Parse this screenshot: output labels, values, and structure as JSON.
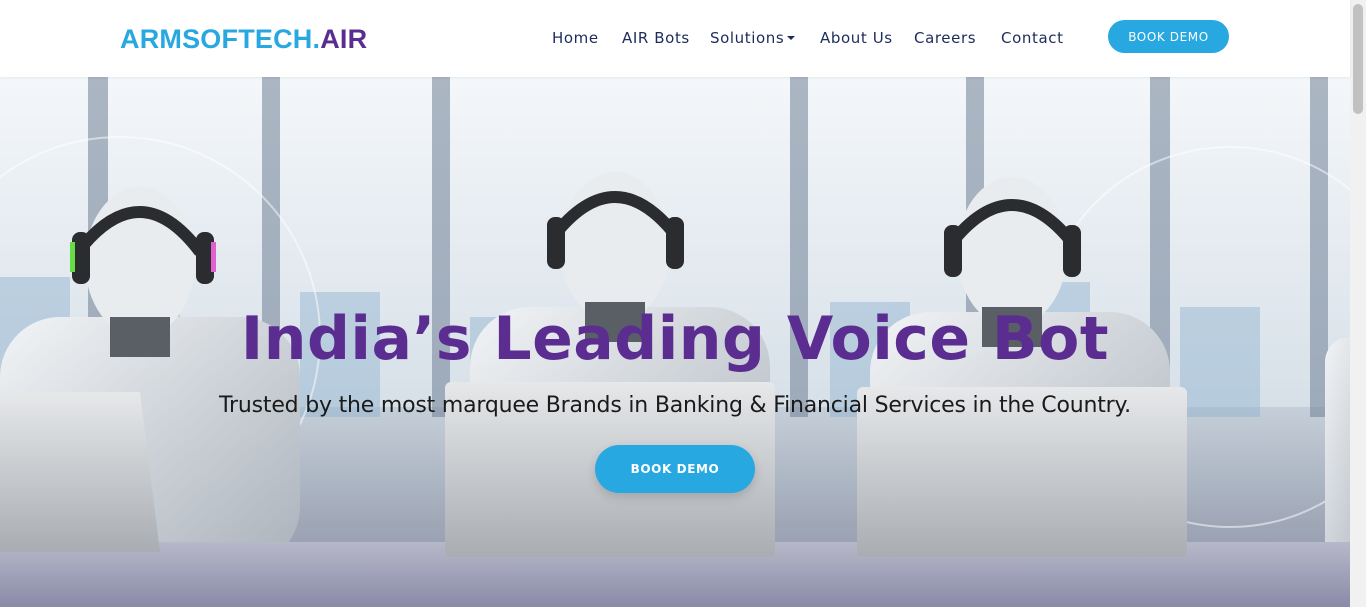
{
  "brand": {
    "logo_part1": "ARMSOFTECH.",
    "logo_part2": "AIR"
  },
  "nav": {
    "items": [
      {
        "label": "Home"
      },
      {
        "label": "AIR Bots"
      },
      {
        "label": "Solutions",
        "has_dropdown": true
      },
      {
        "label": "About Us"
      },
      {
        "label": "Careers"
      },
      {
        "label": "Contact"
      }
    ],
    "cta_label": "BOOK DEMO"
  },
  "hero": {
    "title": "India’s Leading Voice Bot",
    "subtitle": "Trusted by the most marquee Brands in Banking & Financial Services in the Country.",
    "cta_label": "BOOK DEMO"
  },
  "colors": {
    "primary_blue": "#27a8e0",
    "brand_purple": "#5b2d90",
    "nav_text": "#1d2c5c"
  },
  "icons": {
    "dropdown": "caret-down-icon"
  }
}
